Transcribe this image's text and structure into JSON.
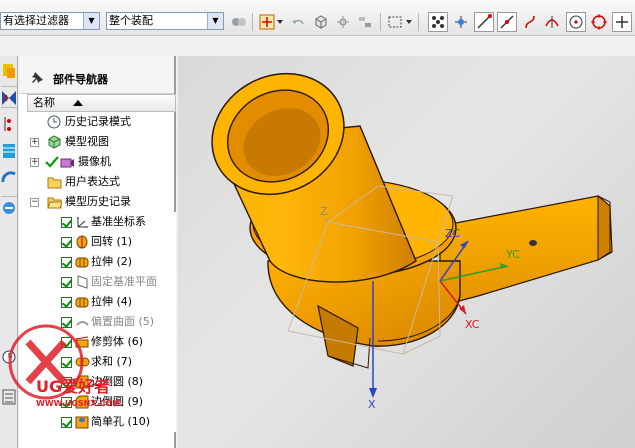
{
  "toolbar": {
    "filter_value": "有选择过滤器",
    "assembly_value": "整个装配"
  },
  "navigator": {
    "title": "部件导航器",
    "column_name": "名称",
    "items": [
      {
        "label": "历史记录模式"
      },
      {
        "label": "模型视图"
      },
      {
        "label": "摄像机"
      },
      {
        "label": "用户表达式"
      },
      {
        "label": "模型历史记录"
      }
    ],
    "features": [
      {
        "label": "基准坐标系"
      },
      {
        "label": "回转 (1)"
      },
      {
        "label": "拉伸 (2)"
      },
      {
        "label": "固定基准平面"
      },
      {
        "label": "拉伸 (4)"
      },
      {
        "label": "偏置曲面 (5)"
      },
      {
        "label": "修剪体 (6)"
      },
      {
        "label": "求和 (7)"
      },
      {
        "label": "边倒圆 (8)"
      },
      {
        "label": "边倒圆 (9)"
      },
      {
        "label": "简单孔 (10)"
      }
    ]
  },
  "viewport": {
    "axis_zc": "ZC",
    "axis_yc": "YC",
    "axis_xc": "XC",
    "axis_z": "Z",
    "axis_x": "X",
    "part_color": "#f5a511"
  },
  "watermark": {
    "brand": "UG爱好者",
    "url": "WWW.UGSNX.COM"
  }
}
